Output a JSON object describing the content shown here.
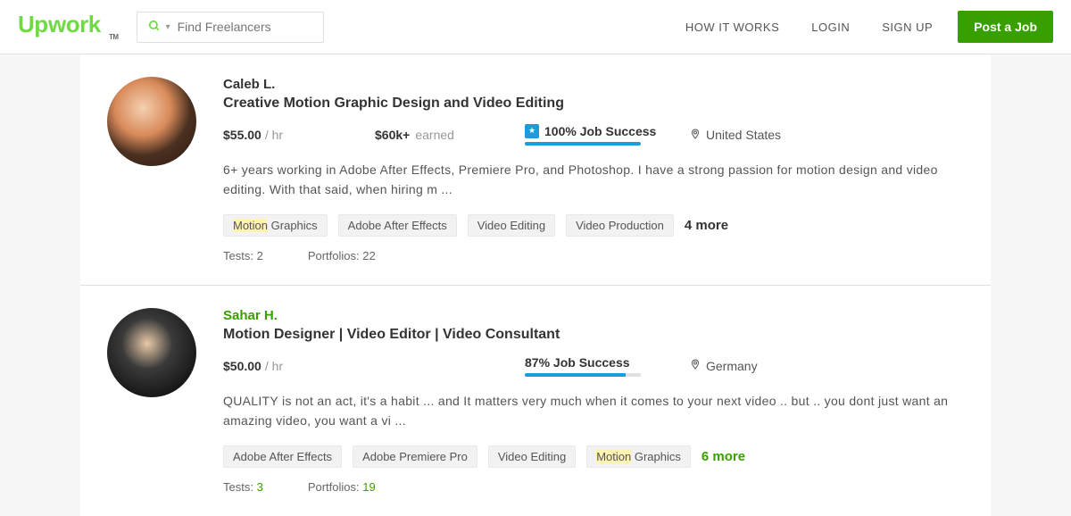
{
  "header": {
    "logo_text": "Upwork",
    "logo_tm": "TM",
    "search_placeholder": "Find Freelancers",
    "nav": {
      "how_it_works": "HOW IT WORKS",
      "login": "LOGIN",
      "sign_up": "SIGN UP",
      "post_job": "Post a Job"
    }
  },
  "freelancers": [
    {
      "name": "Caleb L.",
      "online": false,
      "tagline": "Creative Motion Graphic Design and Video Editing",
      "rate_value": "$55.00",
      "rate_unit": "/ hr",
      "earned_value": "$60k+",
      "earned_label": "earned",
      "show_earned": true,
      "show_shield": true,
      "job_success_text": "100% Job Success",
      "job_success_pct": 100,
      "location": "United States",
      "description": "6+ years working in Adobe After Effects, Premiere Pro, and Photoshop. I have a strong passion for motion design and video editing. With that said, when hiring m ...",
      "tags": [
        {
          "label": "Motion Graphics",
          "highlight": "Motion"
        },
        {
          "label": "Adobe After Effects"
        },
        {
          "label": "Video Editing"
        },
        {
          "label": "Video Production"
        }
      ],
      "more_tags": "4 more",
      "more_green": false,
      "tests_label": "Tests:",
      "tests_value": "2",
      "portfolios_label": "Portfolios:",
      "portfolios_value": "22",
      "meta_green": false
    },
    {
      "name": "Sahar H.",
      "online": true,
      "tagline": "Motion Designer | Video Editor | Video Consultant",
      "rate_value": "$50.00",
      "rate_unit": "/ hr",
      "earned_value": "",
      "earned_label": "",
      "show_earned": false,
      "show_shield": false,
      "job_success_text": "87% Job Success",
      "job_success_pct": 87,
      "location": "Germany",
      "description": "QUALITY is not an act, it's a habit ... and It matters very much when it comes to your next video .. but .. you dont just want an amazing video, you want a vi ...",
      "tags": [
        {
          "label": "Adobe After Effects"
        },
        {
          "label": "Adobe Premiere Pro"
        },
        {
          "label": "Video Editing"
        },
        {
          "label": "Motion Graphics",
          "highlight": "Motion"
        }
      ],
      "more_tags": "6 more",
      "more_green": true,
      "tests_label": "Tests:",
      "tests_value": "3",
      "portfolios_label": "Portfolios:",
      "portfolios_value": "19",
      "meta_green": true
    }
  ]
}
